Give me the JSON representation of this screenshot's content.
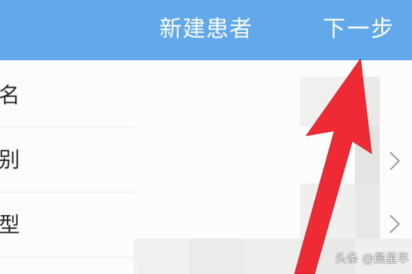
{
  "header": {
    "title": "新建患者",
    "next_label": "下一步"
  },
  "form": {
    "rows": [
      {
        "label": "名"
      },
      {
        "label": "别"
      },
      {
        "label": "型"
      }
    ]
  },
  "icons": {
    "row_chevron": "chevron-right-icon"
  },
  "watermark": "头条 @晨星早",
  "colors": {
    "header_bg": "#62a9ec",
    "arrow": "#ee2a35"
  }
}
